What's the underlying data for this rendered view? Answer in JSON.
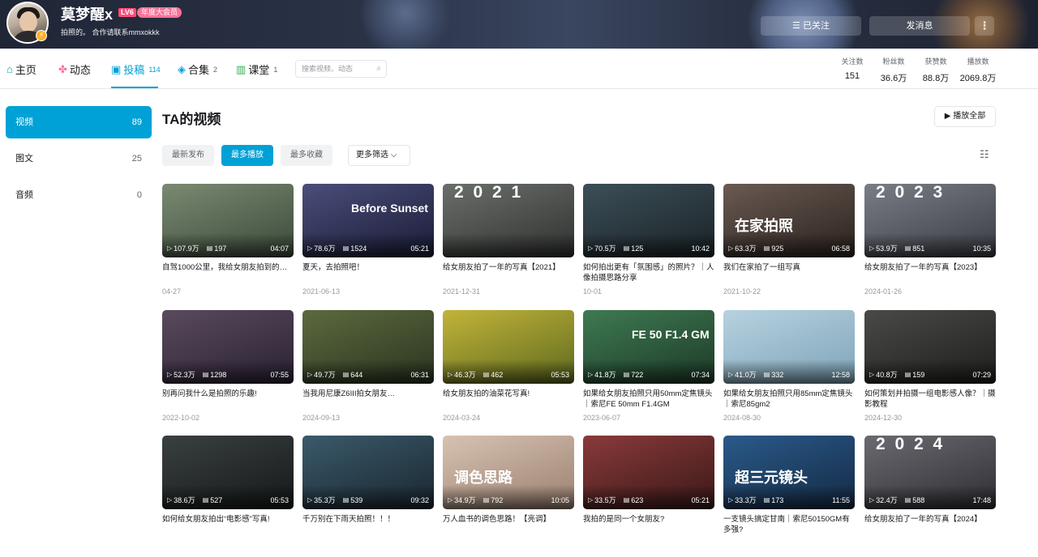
{
  "header": {
    "username": "莫梦醒x",
    "level": "LV6",
    "vip": "年度大会员",
    "sign": "拍照的。 合作请联系mmxokkk",
    "follow_label": "☰ 已关注",
    "message_label": "发消息",
    "more_label": "⋮"
  },
  "nav": {
    "items": [
      {
        "label": "主页",
        "icon": "home-icon",
        "count": ""
      },
      {
        "label": "动态",
        "icon": "pinwheel-icon",
        "count": ""
      },
      {
        "label": "投稿",
        "icon": "tv-icon",
        "count": "114"
      },
      {
        "label": "合集",
        "icon": "layers-icon",
        "count": "2"
      },
      {
        "label": "课堂",
        "icon": "book-icon",
        "count": "1"
      }
    ],
    "search_placeholder": "搜索视频、动态",
    "stats": [
      {
        "label": "关注数",
        "value": "151"
      },
      {
        "label": "粉丝数",
        "value": "36.6万"
      },
      {
        "label": "获赞数",
        "value": "88.8万"
      },
      {
        "label": "播放数",
        "value": "2069.8万"
      }
    ]
  },
  "sidebar": {
    "items": [
      {
        "label": "视频",
        "count": "89"
      },
      {
        "label": "图文",
        "count": "25"
      },
      {
        "label": "音频",
        "count": "0"
      }
    ]
  },
  "main": {
    "title": "TA的视频",
    "play_all": "▶ 播放全部",
    "filters": [
      "最新发布",
      "最多播放",
      "最多收藏"
    ],
    "more_filter": "更多筛选 ⌵"
  },
  "videos": [
    {
      "title": "自驾1000公里，我给女朋友拍到的…",
      "plays": "107.9万",
      "danmaku": "197",
      "duration": "04:07",
      "date": "04-27",
      "overlay": "",
      "colors": [
        "#7a8a72",
        "#3b4a3a"
      ]
    },
    {
      "title": "夏天，去拍照吧！",
      "plays": "78.6万",
      "danmaku": "1524",
      "duration": "05:21",
      "date": "2021-06-13",
      "overlay": "Before Sunset",
      "colors": [
        "#4a4e7a",
        "#1a1c36"
      ]
    },
    {
      "title": "给女朋友拍了一年的写真【2021】",
      "plays": "",
      "danmaku": "",
      "duration": "",
      "date": "2021-12-31",
      "overlay": "2 0 2 1",
      "colors": [
        "#6b6f6a",
        "#2f3130"
      ]
    },
    {
      "title": "如何拍出更有「氛围感」的照片？｜人像拍摄思路分享",
      "plays": "70.5万",
      "danmaku": "125",
      "duration": "10:42",
      "date": "10-01",
      "overlay": "",
      "colors": [
        "#3c4f58",
        "#1a2226"
      ]
    },
    {
      "title": "我们在家拍了一组写真",
      "plays": "63.3万",
      "danmaku": "925",
      "duration": "06:58",
      "date": "2021-10-22",
      "overlay": "在家拍照",
      "colors": [
        "#6a5a52",
        "#2a221e"
      ]
    },
    {
      "title": "给女朋友拍了一年的写真【2023】",
      "plays": "53.9万",
      "danmaku": "851",
      "duration": "10:35",
      "date": "2024-01-26",
      "overlay": "2 0 2 3",
      "colors": [
        "#7a7d85",
        "#3a3d44"
      ]
    },
    {
      "title": "别再问我什么是拍照的乐趣!",
      "plays": "52.3万",
      "danmaku": "1298",
      "duration": "07:55",
      "date": "2022-10-02",
      "overlay": "",
      "colors": [
        "#5a4a5e",
        "#2a2233"
      ]
    },
    {
      "title": "当我用尼康Z6III拍女朋友…",
      "plays": "49.7万",
      "danmaku": "644",
      "duration": "06:31",
      "date": "2024-09-13",
      "overlay": "",
      "colors": [
        "#5c6a3e",
        "#2a3420"
      ]
    },
    {
      "title": "给女朋友拍的油菜花写真!",
      "plays": "46.3万",
      "danmaku": "462",
      "duration": "05:53",
      "date": "2024-03-24",
      "overlay": "",
      "colors": [
        "#c2b43a",
        "#5e6a1e"
      ]
    },
    {
      "title": "如果给女朋友拍照只用50mm定焦镜头｜索尼FE 50mm F1.4GM",
      "plays": "41.8万",
      "danmaku": "722",
      "duration": "07:34",
      "date": "2023-06-07",
      "overlay": "FE 50 F1.4 GM",
      "colors": [
        "#3f7a52",
        "#1c3a28"
      ]
    },
    {
      "title": "如果给女朋友拍照只用85mm定焦镜头｜索尼85gm2",
      "plays": "41.0万",
      "danmaku": "332",
      "duration": "12:58",
      "date": "2024-08-30",
      "overlay": "",
      "colors": [
        "#b7d2e0",
        "#7ea4b8"
      ]
    },
    {
      "title": "如何策划并拍摄一组电影感人像？｜摄影教程",
      "plays": "40.8万",
      "danmaku": "159",
      "duration": "07:29",
      "date": "2024-12-30",
      "overlay": "",
      "colors": [
        "#4a4a48",
        "#1e1e1c"
      ]
    },
    {
      "title": "如何给女朋友拍出“电影感”写真!",
      "plays": "38.6万",
      "danmaku": "527",
      "duration": "05:53",
      "date": "",
      "overlay": "",
      "colors": [
        "#3a4040",
        "#151818"
      ]
    },
    {
      "title": "千万别在下雨天拍照！！！",
      "plays": "35.3万",
      "danmaku": "539",
      "duration": "09:32",
      "date": "",
      "overlay": "",
      "colors": [
        "#3a5a6a",
        "#1a2630"
      ]
    },
    {
      "title": "万人血书的调色思路！【亮调】",
      "plays": "34.9万",
      "danmaku": "792",
      "duration": "10:05",
      "date": "",
      "overlay": "调色思路",
      "colors": [
        "#d7c2b2",
        "#9a8070"
      ]
    },
    {
      "title": "我拍的是同一个女朋友?",
      "plays": "33.5万",
      "danmaku": "623",
      "duration": "05:21",
      "date": "",
      "overlay": "",
      "colors": [
        "#8a3a3a",
        "#3a1818"
      ]
    },
    {
      "title": "一支镜头搞定甘南｜索尼50150GM有多强?",
      "plays": "33.3万",
      "danmaku": "173",
      "duration": "11:55",
      "date": "",
      "overlay": "超三元镜头",
      "colors": [
        "#2a5a8a",
        "#142a44"
      ]
    },
    {
      "title": "给女朋友拍了一年的写真【2024】",
      "plays": "32.4万",
      "danmaku": "588",
      "duration": "17:48",
      "date": "",
      "overlay": "2 0 2 4",
      "colors": [
        "#6a6a70",
        "#2e2e34"
      ]
    }
  ]
}
